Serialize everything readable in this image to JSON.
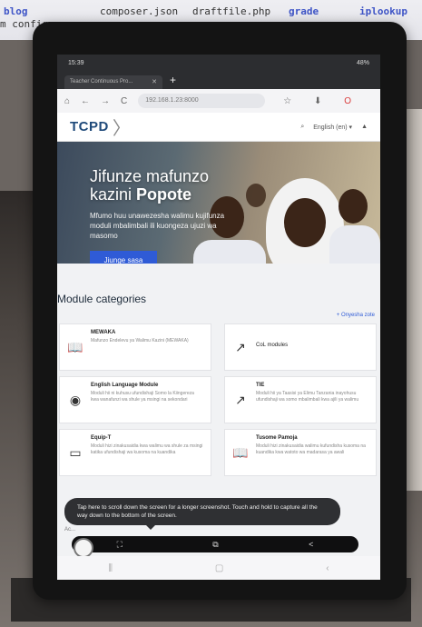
{
  "background": {
    "files": [
      "blog",
      "composer.json",
      "draftfile.php",
      "grade",
      "iplookup"
    ],
    "config_text": "m config"
  },
  "status_bar": {
    "time": "15:39",
    "battery": "48%"
  },
  "browser": {
    "tab_title": "Teacher Continuous Pro...",
    "url": "192.168.1.23:8000",
    "icons": {
      "back": "←",
      "forward": "→",
      "reload": "C",
      "home": "⌂",
      "star": "☆",
      "download": "⬇",
      "menu": "O"
    }
  },
  "site": {
    "logo": "TCPD",
    "language": "English (en) ▾",
    "hero": {
      "title_line1": "Jifunze mafunzo",
      "title_line2_plain": "kazini ",
      "title_line2_bold": "Popote",
      "subtitle": "Mfumo huu unawezesha walimu kujifunza moduli mbalimbali ili kuongeza ujuzi wa masomo",
      "button": "Jiunge sasa"
    },
    "categories_title": "Module categories",
    "view_all": "+ Onyesha zote",
    "cards": [
      {
        "title": "MEWAKA",
        "desc": "Mafunzo Endelevu ya Walimu Kazini (MEWAKA)",
        "icon": "book"
      },
      {
        "title": "CoL modules",
        "desc": "",
        "icon": "chart"
      },
      {
        "title": "English Language Module",
        "desc": "Moduli hii ni kuhusu ufundishaji Somo la Kiingereza kwa wanafunzi wa shule ya msingi na sekondari",
        "icon": "camera"
      },
      {
        "title": "TIE",
        "desc": "Moduli hii ya Taasisi ya Elimu Tanzania inayohusu ufundishaji wa somo mbalimbali kwa ajili ya walimu",
        "icon": "chart"
      },
      {
        "title": "Equip-T",
        "desc": "Moduli hizi zinakusaidia kwa walimu wa shule za msingi katika ufundishaji wa kusoma na kuandika",
        "icon": "monitor"
      },
      {
        "title": "Tusome Pamoja",
        "desc": "Moduli hizi zinakusaidia walimu kufundisha kusoma na kuandika kwa watoto wa madarasa ya awali",
        "icon": "book"
      }
    ]
  },
  "capture": {
    "toast": "Tap here to scroll down the screen for a longer screenshot. Touch and hold to capture all the way down to the bottom of the screen.",
    "under_toast": "Ac...",
    "icons": {
      "crop": "⛶",
      "edit": "⧉",
      "share": "<"
    }
  },
  "navbar": {
    "recents": "⫼",
    "home": "▢",
    "back": "‹"
  }
}
